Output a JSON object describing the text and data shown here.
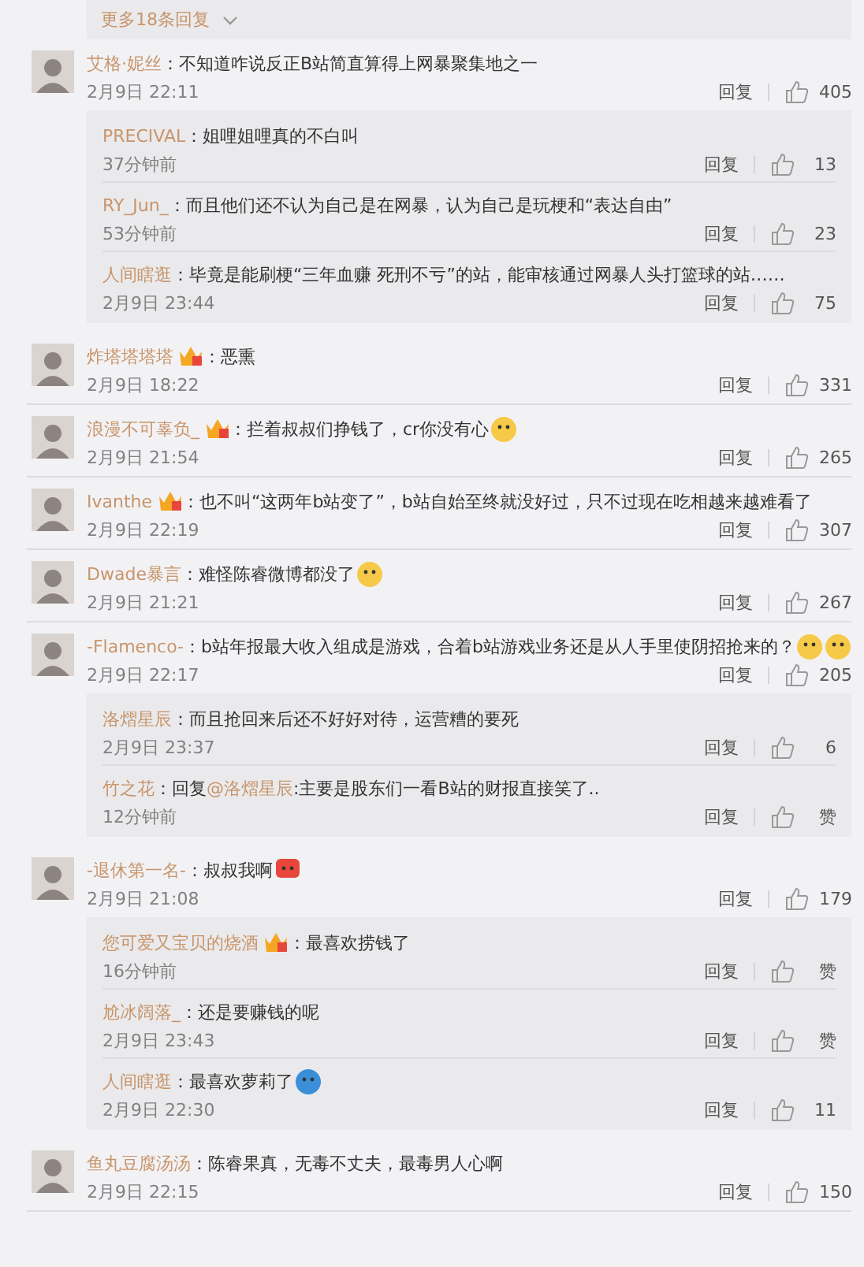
{
  "more_replies": {
    "label": "更多18条回复"
  },
  "comments": [
    {
      "name": "艾格·妮丝",
      "text": "：不知道咋说反正B站简直算得上网暴聚集地之一",
      "time": "2月9日 22:11",
      "reply_label": "回复",
      "likes": "405",
      "replies": [
        {
          "name": "PRECIVAL",
          "text": "：姐哩姐哩真的不白叫",
          "time": "37分钟前",
          "reply_label": "回复",
          "likes": "13"
        },
        {
          "name": "RY_Jun_",
          "text": "：而且他们还不认为自己是在网暴，认为自己是玩梗和“表达自由”",
          "time": "53分钟前",
          "reply_label": "回复",
          "likes": "23"
        },
        {
          "name": "人间瞎逛",
          "text": "：毕竟是能刷梗“三年血赚 死刑不亏”的站，能审核通过网暴人头打篮球的站……",
          "time": "2月9日 23:44",
          "reply_label": "回复",
          "likes": "75"
        }
      ]
    },
    {
      "name": "炸塔塔塔塔",
      "vip": true,
      "text": "：恶熏",
      "time": "2月9日 18:22",
      "reply_label": "回复",
      "likes": "331"
    },
    {
      "name": "浪漫不可辜负_",
      "vip": true,
      "text": "：拦着叔叔们挣钱了，cr你没有心",
      "emojis": [
        {
          "kind": "face"
        }
      ],
      "time": "2月9日 21:54",
      "reply_label": "回复",
      "likes": "265"
    },
    {
      "name": "Ivanthe",
      "vip": true,
      "text": "：也不叫“这两年b站变了”，b站自始至终就没好过，只不过现在吃相越来越难看了",
      "time": "2月9日 22:19",
      "reply_label": "回复",
      "likes": "307"
    },
    {
      "name": "Dwade暴言",
      "text": "：难怪陈睿微博都没了",
      "emojis": [
        {
          "kind": "face"
        }
      ],
      "time": "2月9日 21:21",
      "reply_label": "回复",
      "likes": "267"
    },
    {
      "name": "-Flamenco-",
      "text": "：b站年报最大收入组成是游戏，合着b站游戏业务还是从人手里使阴招抢来的？",
      "emojis": [
        {
          "kind": "face"
        },
        {
          "kind": "face"
        }
      ],
      "time": "2月9日 22:17",
      "reply_label": "回复",
      "likes": "205",
      "replies": [
        {
          "name": "洛熠星辰",
          "text": "：而且抢回来后还不好好对待，运营糟的要死",
          "time": "2月9日 23:37",
          "reply_label": "回复",
          "likes": "6"
        },
        {
          "name": "竹之花",
          "text": "：回复",
          "mention": "@洛熠星辰",
          "text_after": ":主要是股东们一看B站的财报直接笑了..",
          "time": "12分钟前",
          "reply_label": "回复",
          "likes": "赞"
        }
      ]
    },
    {
      "name": "-退休第一名-",
      "text": "：叔叔我啊",
      "emojis": [
        {
          "kind": "bubble"
        }
      ],
      "time": "2月9日 21:08",
      "reply_label": "回复",
      "likes": "179",
      "replies": [
        {
          "name": "您可爱又宝贝的烧酒",
          "vip": true,
          "text": "：最喜欢捞钱了",
          "time": "16分钟前",
          "reply_label": "回复",
          "likes": "赞"
        },
        {
          "name": "尬冰阔落_",
          "text": "：还是要赚钱的呢",
          "time": "2月9日 23:43",
          "reply_label": "回复",
          "likes": "赞"
        },
        {
          "name": "人间瞎逛",
          "text": "：最喜欢萝莉了",
          "emojis": [
            {
              "kind": "blueface"
            }
          ],
          "time": "2月9日 22:30",
          "reply_label": "回复",
          "likes": "11"
        }
      ]
    },
    {
      "name": "鱼丸豆腐汤汤",
      "text": "：陈睿果真，无毒不丈夫，最毒男人心啊",
      "time": "2月9日 22:15",
      "reply_label": "回复",
      "likes": "150"
    }
  ]
}
